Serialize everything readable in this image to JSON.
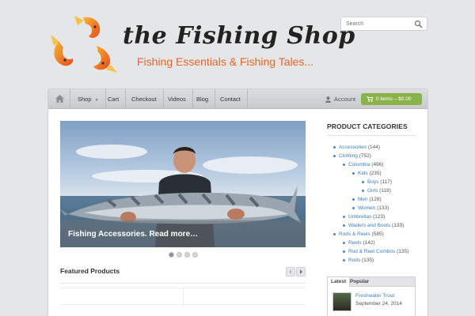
{
  "brand": {
    "title": "the Fishing Shop",
    "tagline": "Fishing Essentials & Fishing Tales...",
    "logo_icon": "three-fish-logo",
    "accent": "#e8652a"
  },
  "search": {
    "placeholder": "Search",
    "icon": "search-icon"
  },
  "nav": {
    "home_icon": "home-icon",
    "items": [
      {
        "label": "Shop",
        "has_dropdown": true
      },
      {
        "label": "Cart"
      },
      {
        "label": "Checkout"
      },
      {
        "label": "Videos"
      },
      {
        "label": "Blog"
      },
      {
        "label": "Contact"
      }
    ],
    "account_label": "Account",
    "cart_button": "0 items – $0.00",
    "cart_color": "#8ab24a"
  },
  "slider": {
    "caption": "Fishing Accessories. Read more…",
    "slide_count": 4,
    "active_slide": 1
  },
  "featured": {
    "title": "Featured Products"
  },
  "sidebar": {
    "title": "PRODUCT CATEGORIES",
    "categories": [
      {
        "name": "Accessories",
        "count": "(144)",
        "level": 0
      },
      {
        "name": "Clothing",
        "count": "(752)",
        "level": 0
      },
      {
        "name": "Columbia",
        "count": "(496)",
        "level": 1
      },
      {
        "name": "Kids",
        "count": "(235)",
        "level": 2
      },
      {
        "name": "Boys",
        "count": "(117)",
        "level": 3
      },
      {
        "name": "Girls",
        "count": "(118)",
        "level": 3
      },
      {
        "name": "Men",
        "count": "(128)",
        "level": 2
      },
      {
        "name": "Women",
        "count": "(133)",
        "level": 2
      },
      {
        "name": "Umbrellas",
        "count": "(123)",
        "level": 1
      },
      {
        "name": "Waders and Boots",
        "count": "(133)",
        "level": 1
      },
      {
        "name": "Rods & Reels",
        "count": "(585)",
        "level": 0
      },
      {
        "name": "Reels",
        "count": "(142)",
        "level": 1
      },
      {
        "name": "Rod & Reel Combos",
        "count": "(135)",
        "level": 1
      },
      {
        "name": "Rods",
        "count": "(135)",
        "level": 1
      }
    ],
    "tabs": [
      "Latest",
      "Popular"
    ],
    "latest": {
      "title": "Freshwater Trout",
      "date": "September 24, 2014"
    }
  }
}
